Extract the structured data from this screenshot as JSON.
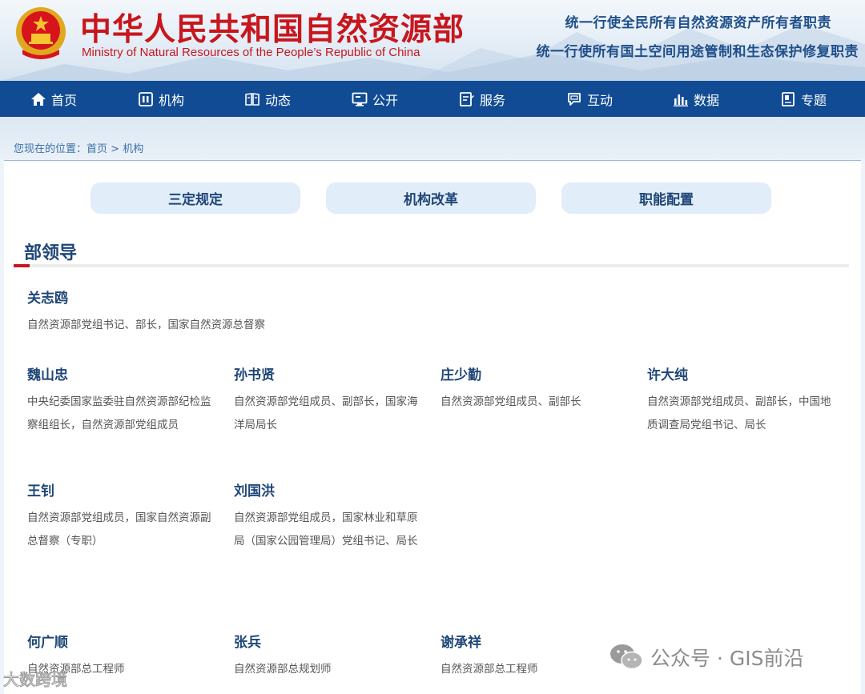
{
  "header": {
    "title": "中华人民共和国自然资源部",
    "subtitle": "Ministry of Natural Resources of the People’s Republic of China",
    "slogan_1": "统一行使全民所有自然资源资产所有者职责",
    "slogan_2": "统一行使所有国土空间用途管制和生态保护修复职责",
    "emblem_icon": "national-emblem-icon"
  },
  "nav": {
    "items": [
      {
        "label": "首页",
        "icon": "home-icon"
      },
      {
        "label": "机构",
        "icon": "organization-icon"
      },
      {
        "label": "动态",
        "icon": "news-icon"
      },
      {
        "label": "公开",
        "icon": "disclosure-icon"
      },
      {
        "label": "服务",
        "icon": "service-icon"
      },
      {
        "label": "互动",
        "icon": "interaction-icon"
      },
      {
        "label": "数据",
        "icon": "data-chart-icon"
      },
      {
        "label": "专题",
        "icon": "topic-icon"
      }
    ]
  },
  "breadcrumb": {
    "prefix": "您现在的位置：",
    "home": "首页",
    "separator": " > ",
    "current": "机构"
  },
  "tabs": [
    "三定规定",
    "机构改革",
    "职能配置"
  ],
  "section": {
    "title": "部领导"
  },
  "leaders": [
    {
      "name": "关志鸥",
      "title": "自然资源部党组书记、部长，国家自然资源总督察"
    },
    {
      "name": "魏山忠",
      "title": "中央纪委国家监委驻自然资源部纪检监察组组长，自然资源部党组成员"
    },
    {
      "name": "孙书贤",
      "title": "自然资源部党组成员、副部长，国家海洋局局长"
    },
    {
      "name": "庄少勤",
      "title": "自然资源部党组成员、副部长"
    },
    {
      "name": "许大纯",
      "title": "自然资源部党组成员、副部长，中国地质调查局党组书记、局长"
    },
    {
      "name": "王钊",
      "title": "自然资源部党组成员，国家自然资源副总督察（专职）"
    },
    {
      "name": "刘国洪",
      "title": "自然资源部党组成员，国家林业和草原局（国家公园管理局）党组书记、局长"
    },
    {
      "name": "何广顺",
      "title": "自然资源部总工程师"
    },
    {
      "name": "张兵",
      "title": "自然资源部总规划师"
    },
    {
      "name": "谢承祥",
      "title": "自然资源部总工程师"
    }
  ],
  "watermark": {
    "right": "公众号 · GIS前沿",
    "left": "大数跨境",
    "icon": "wechat-icon"
  },
  "colors": {
    "brand_red": "#c8161d",
    "nav_blue": "#114b93",
    "heading_blue": "#1e4677",
    "tab_bg": "#e1edf8"
  }
}
